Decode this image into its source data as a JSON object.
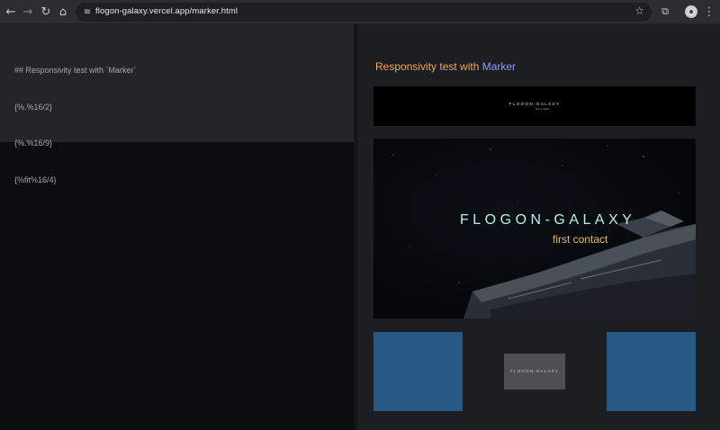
{
  "browser": {
    "url": "flogon-galaxy.vercel.app/marker.html",
    "nav_icons": [
      "back-icon",
      "forward-icon",
      "reload-icon",
      "home-icon"
    ],
    "toolbar_icons": [
      "bookmark-star-icon",
      "extensions-icon",
      "profile-avatar",
      "menu-icon"
    ]
  },
  "editor": {
    "lines": [
      "## Responsivity test with `Marker`",
      "{%.%16/2}",
      "{%.%16/9}",
      "{%fit%16/4}"
    ]
  },
  "preview": {
    "heading_text": "Responsivity test with ",
    "heading_link": "Marker",
    "banner_title": "FLOGON-GALAXY",
    "banner_subtitle": "first contact",
    "small_banner_title": "FLOGON-GALAXY",
    "small_banner_subtitle": "first contact",
    "chip_title": "FLOGON-GALAXY"
  },
  "colors": {
    "heading": "#f2a65a",
    "link": "#8c9aff",
    "title": "#b9f0dc",
    "subtitle": "#f2b46a",
    "tile": "#265a85"
  }
}
